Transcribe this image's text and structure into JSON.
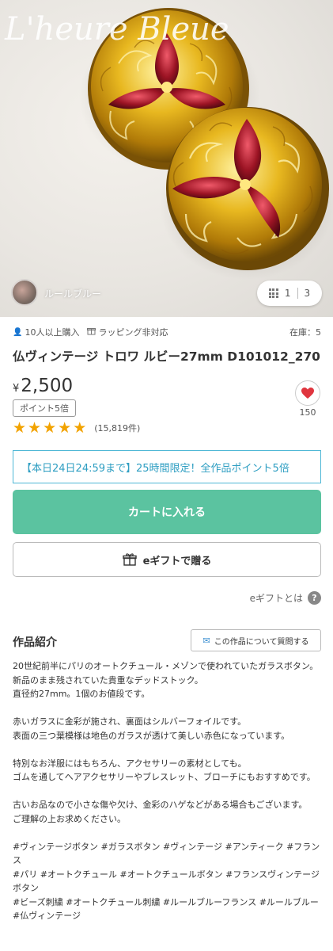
{
  "hero": {
    "brand_text": "L'heure Bleue",
    "shop_name": "ルールブルー",
    "pager": {
      "current": "1",
      "total": "3"
    }
  },
  "meta": {
    "purchase_count": "10人以上購入",
    "wrapping": "ラッピング非対応",
    "stock": "在庫：5"
  },
  "product": {
    "title": "仏ヴィンテージ トロワ ルビー27mm D101012_270",
    "currency": "¥",
    "price": "2,500",
    "point_badge": "ポイント5倍",
    "rating": 5,
    "review_count": "(15,819件)",
    "favorite_count": "150"
  },
  "campaign": "【本日24日24:59まで】25時間限定！全作品ポイント5倍",
  "buttons": {
    "cart": "カートに入れる",
    "gift": "eギフトで贈る",
    "gift_help": "eギフトとは",
    "ask": "この作品について質問する"
  },
  "description": {
    "heading": "作品紹介",
    "paragraphs": [
      "20世紀前半にパリのオートクチュール・メゾンで使われていたガラスボタン。\n新品のまま残されていた貴重なデッドストック。\n直径約27mm。1個のお値段です。",
      "赤いガラスに金彩が施され、裏面はシルバーフォイルです。\n表面の三つ葉模様は地色のガラスが透けて美しい赤色になっています。",
      "特別なお洋服にはもちろん、アクセサリーの素材としても。\nゴムを通してヘアアクセサリーやブレスレット、ブローチにもおすすめです。",
      "古いお品なので小さな傷や欠け、金彩のハゲなどがある場合もございます。\nご理解の上お求めください。",
      "#ヴィンテージボタン #ガラスボタン #ヴィンテージ #アンティーク #フランス\n#パリ #オートクチュール #オートクチュールボタン #フランスヴィンテージボタン\n#ビーズ刺繍 #オートクチュール刺繍 #ルールブルーフランス #ルールブルー\n#仏ヴィンテージ"
    ]
  },
  "icons": {
    "person": "person-icon",
    "gift": "gift-icon",
    "heart": "heart-icon",
    "grid": "grid-icon",
    "help": "help-icon",
    "mail": "mail-icon",
    "star": "star-icon"
  },
  "colors": {
    "cart_button": "#5bc3a0",
    "campaign_border": "#4fb8d6",
    "campaign_text": "#2e9ec2",
    "star": "#f2a300",
    "heart": "#e0353e"
  }
}
